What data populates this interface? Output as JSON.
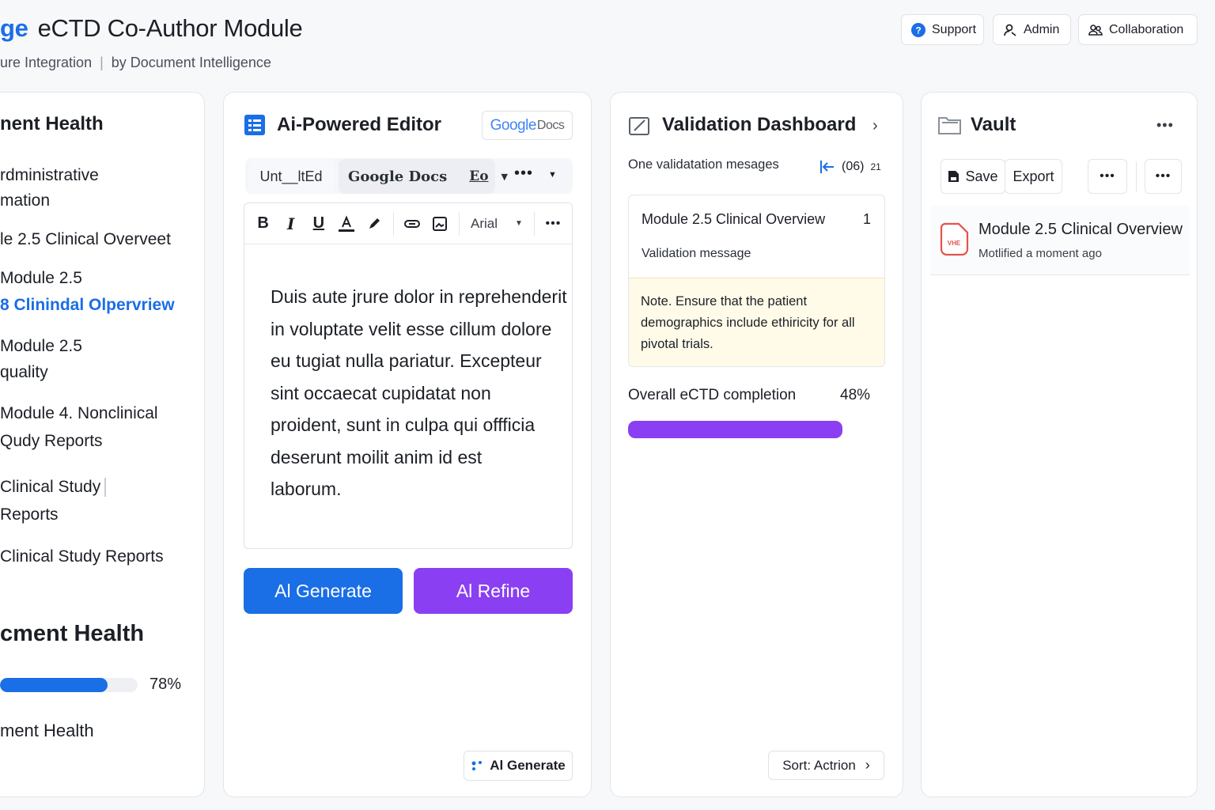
{
  "header": {
    "brand_prefix": "ge",
    "title": "eCTD Co-Author Module",
    "subtitle_left": "ure Integration",
    "subtitle_sep": "|",
    "subtitle_right": "by Document Intelligence",
    "buttons": {
      "support": "Support",
      "admin": "Admin",
      "collaboration": "Collaboration"
    }
  },
  "left_panel": {
    "title": "nent Health",
    "nav": [
      "rdministrative",
      "mation",
      "le 2.5 Clinical Overveet",
      "Module 2.5",
      "8 Clinindal Olpervriew",
      "Module 2.5",
      "quality",
      "Module 4. Nonclinical",
      "Qudy Reports",
      "Clinical Study",
      "Reports",
      "Clinical Study Reports"
    ],
    "health_title": "cment Health",
    "health_percent": "78%",
    "health_value": 78,
    "footer_label": "ment Health"
  },
  "editor": {
    "title": "Ai-Powered Editor",
    "google_docs_badge": {
      "google": "Google",
      "docs": "Docs"
    },
    "tabs": {
      "untitled": "Unt__ltEd",
      "google_docs": "Google Docs",
      "tab_icon_text": "Eo"
    },
    "toolbar": {
      "bold": "B",
      "italic": "I",
      "underline": "U",
      "font": "Arial"
    },
    "body_lines": [
      "Duis aute jrure dolor in reprehenderit",
      "in voluptate velit esse cillum dolore",
      "eu tugiat nulla pariatur. Excepteur",
      "sint occaecat cupidatat non",
      "proident, sunt in culpa qui offficia",
      "deserunt moilit anim id est",
      "laborum."
    ],
    "ai_generate": "Al Generate",
    "ai_refine": "Al Refine",
    "ai_generate_small": "Al Generate"
  },
  "validation": {
    "title": "Validation Dashboard",
    "messages_label": "One validatation mesages",
    "counter": "(06)",
    "counter_small": "21",
    "card_title": "Module 2.5 Clinical Overview",
    "card_count": "1",
    "card_sub": "Validation message",
    "note": "Note. Ensure that the patient demographics include ethiricity for all pivotal trials.",
    "completion_label": "Overall eCTD completion",
    "completion_percent": "48%",
    "completion_value": 48,
    "sort_label": "Sort: Actrion"
  },
  "vault": {
    "title": "Vault",
    "save": "Save",
    "export": "Export",
    "file_icon_text": "VHE",
    "file_name": "Module 2.5 Clinical Overview",
    "file_meta": "Motlified a moment ago"
  },
  "colors": {
    "primary": "#1a6ee6",
    "purple": "#8a3ff2",
    "note_bg": "#fffbe8",
    "file_red": "#e5534b"
  }
}
